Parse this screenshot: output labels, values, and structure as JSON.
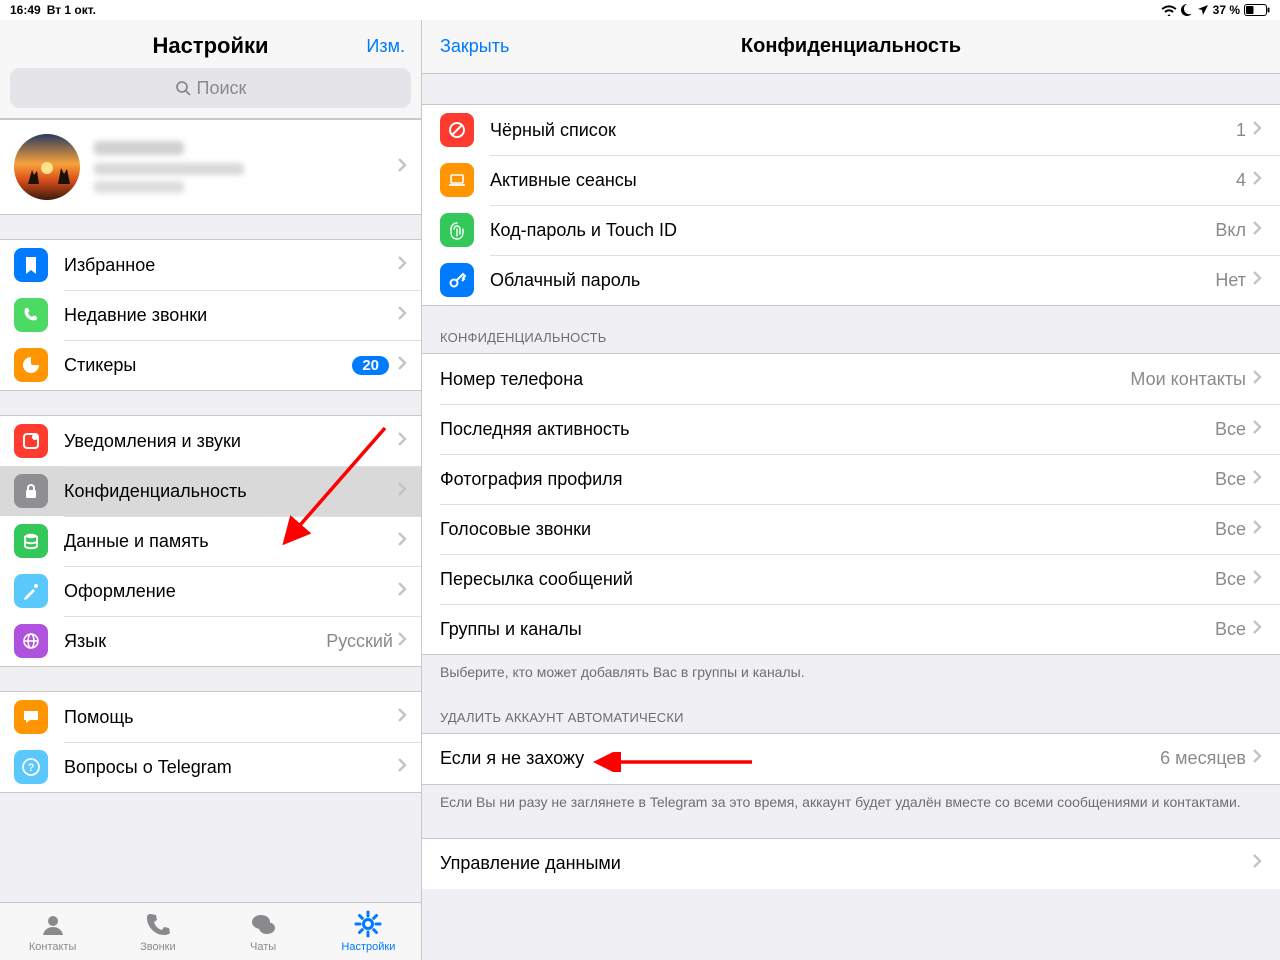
{
  "status": {
    "time": "16:49",
    "date": "Вт 1 окт.",
    "battery": "37 %"
  },
  "sidebar": {
    "title": "Настройки",
    "edit": "Изм.",
    "search_placeholder": "Поиск",
    "groups": [
      {
        "items": [
          {
            "key": "saved",
            "label": "Избранное",
            "icon": "bookmark",
            "color": "ic-blue"
          },
          {
            "key": "calls",
            "label": "Недавние звонки",
            "icon": "phone",
            "color": "ic-green"
          },
          {
            "key": "stickers",
            "label": "Стикеры",
            "icon": "sticker",
            "color": "ic-orange",
            "badge": "20"
          }
        ]
      },
      {
        "items": [
          {
            "key": "notif",
            "label": "Уведомления и звуки",
            "icon": "notif",
            "color": "ic-red"
          },
          {
            "key": "privacy",
            "label": "Конфиденциальность",
            "icon": "lock",
            "color": "ic-gray",
            "selected": true
          },
          {
            "key": "data",
            "label": "Данные и память",
            "icon": "data",
            "color": "ic-lightgreen"
          },
          {
            "key": "appearance",
            "label": "Оформление",
            "icon": "brush",
            "color": "ic-teal"
          },
          {
            "key": "lang",
            "label": "Язык",
            "icon": "globe",
            "color": "ic-purple",
            "value": "Русский"
          }
        ]
      },
      {
        "items": [
          {
            "key": "help",
            "label": "Помощь",
            "icon": "chat",
            "color": "ic-orange"
          },
          {
            "key": "faq",
            "label": "Вопросы о Telegram",
            "icon": "question",
            "color": "ic-teal"
          }
        ]
      }
    ],
    "tabs": [
      {
        "key": "contacts",
        "label": "Контакты",
        "icon": "contacts"
      },
      {
        "key": "calls",
        "label": "Звонки",
        "icon": "phone-tab"
      },
      {
        "key": "chats",
        "label": "Чаты",
        "icon": "chats"
      },
      {
        "key": "settings",
        "label": "Настройки",
        "icon": "gear",
        "active": true
      }
    ]
  },
  "detail": {
    "close": "Закрыть",
    "title": "Конфиденциальность",
    "security": [
      {
        "key": "blocked",
        "label": "Чёрный список",
        "icon": "block",
        "color": "ic-red",
        "value": "1"
      },
      {
        "key": "sessions",
        "label": "Активные сеансы",
        "icon": "laptop",
        "color": "ic-orange",
        "value": "4"
      },
      {
        "key": "passcode",
        "label": "Код-пароль и Touch ID",
        "icon": "finger",
        "color": "ic-lightgreen",
        "value": "Вкл"
      },
      {
        "key": "cloudpwd",
        "label": "Облачный пароль",
        "icon": "key",
        "color": "ic-blue",
        "value": "Нет"
      }
    ],
    "privacy_header": "КОНФИДЕНЦИАЛЬНОСТЬ",
    "privacy": [
      {
        "key": "phone",
        "label": "Номер телефона",
        "value": "Мои контакты"
      },
      {
        "key": "lastseen",
        "label": "Последняя активность",
        "value": "Все"
      },
      {
        "key": "photo",
        "label": "Фотография профиля",
        "value": "Все"
      },
      {
        "key": "voice",
        "label": "Голосовые звонки",
        "value": "Все"
      },
      {
        "key": "forward",
        "label": "Пересылка сообщений",
        "value": "Все"
      },
      {
        "key": "groups",
        "label": "Группы и каналы",
        "value": "Все"
      }
    ],
    "privacy_footer": "Выберите, кто может добавлять Вас в группы и каналы.",
    "delete_header": "УДАЛИТЬ АККАУНТ АВТОМАТИЧЕСКИ",
    "delete": {
      "label": "Если я не захожу",
      "value": "6 месяцев"
    },
    "delete_footer": "Если Вы ни разу не заглянете в Telegram за это время, аккаунт будет удалён вместе со всеми сообщениями и контактами.",
    "manage_header_spacer": true,
    "manage": {
      "label": "Управление данными"
    }
  }
}
